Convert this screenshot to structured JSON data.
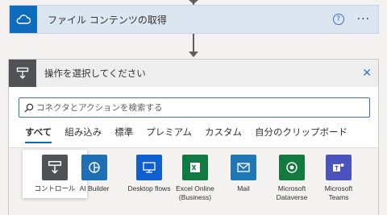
{
  "action_card": {
    "title": "ファイル コンテンツの取得",
    "help_symbol": "?",
    "more_symbol": "···"
  },
  "panel": {
    "title": "操作を選択してください",
    "close_symbol": "✕",
    "search": {
      "placeholder": "コネクタとアクションを検索する",
      "value": ""
    },
    "tabs": [
      {
        "label": "すべて",
        "active": true
      },
      {
        "label": "組み込み",
        "active": false
      },
      {
        "label": "標準",
        "active": false
      },
      {
        "label": "プレミアム",
        "active": false
      },
      {
        "label": "カスタム",
        "active": false
      },
      {
        "label": "自分のクリップボード",
        "active": false
      }
    ],
    "tiles": [
      {
        "label": "コントロール",
        "icon": "control-icon",
        "color": "#505255",
        "selected": true
      },
      {
        "label": "AI Builder",
        "icon": "ai-builder-icon",
        "color": "#1e6fb4",
        "selected": false
      },
      {
        "label": "Desktop flows",
        "icon": "desktop-flows-icon",
        "color": "#0f5fd1",
        "selected": false
      },
      {
        "label": "Excel Online (Business)",
        "icon": "excel-icon",
        "color": "#117a42",
        "selected": false
      },
      {
        "label": "Mail",
        "icon": "mail-icon",
        "color": "#1f78b4",
        "selected": false
      },
      {
        "label": "Microsoft Dataverse",
        "icon": "dataverse-icon",
        "color": "#137a3f",
        "selected": false
      },
      {
        "label": "Microsoft Teams",
        "icon": "teams-icon",
        "color": "#4b53bc",
        "selected": false
      }
    ]
  },
  "colors": {
    "accent": "#0f6cbd",
    "action_card_bg": "#dce6f1",
    "panel_header_bg": "#eeeeee"
  }
}
